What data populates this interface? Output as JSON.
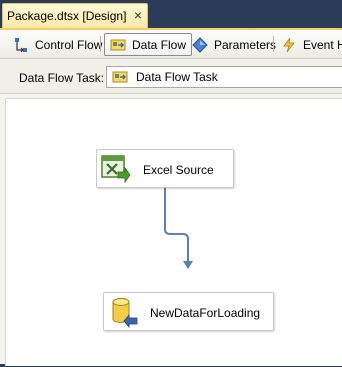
{
  "document_tab": {
    "title": "Package.dtsx [Design]",
    "close_glyph": "×"
  },
  "designer_tabs": [
    {
      "label": "Control Flow",
      "icon": "control-flow-icon",
      "active": false
    },
    {
      "label": "Data Flow",
      "icon": "data-flow-icon",
      "active": true
    },
    {
      "label": "Parameters",
      "icon": "parameters-icon",
      "active": false
    },
    {
      "label": "Event Ha",
      "icon": "event-handlers-icon",
      "active": false
    }
  ],
  "task_selector": {
    "label": "Data Flow Task:",
    "value": "Data Flow Task",
    "icon": "data-flow-task-icon"
  },
  "components": [
    {
      "label": "Excel Source",
      "icon": "excel-source-icon"
    },
    {
      "label": "NewDataForLoading",
      "icon": "database-destination-icon"
    }
  ],
  "colors": {
    "chrome_background": "#2b3c59",
    "active_doc_tab": "#ffe8a6",
    "connector": "#5b7fb1",
    "canvas": "#ffffff"
  }
}
